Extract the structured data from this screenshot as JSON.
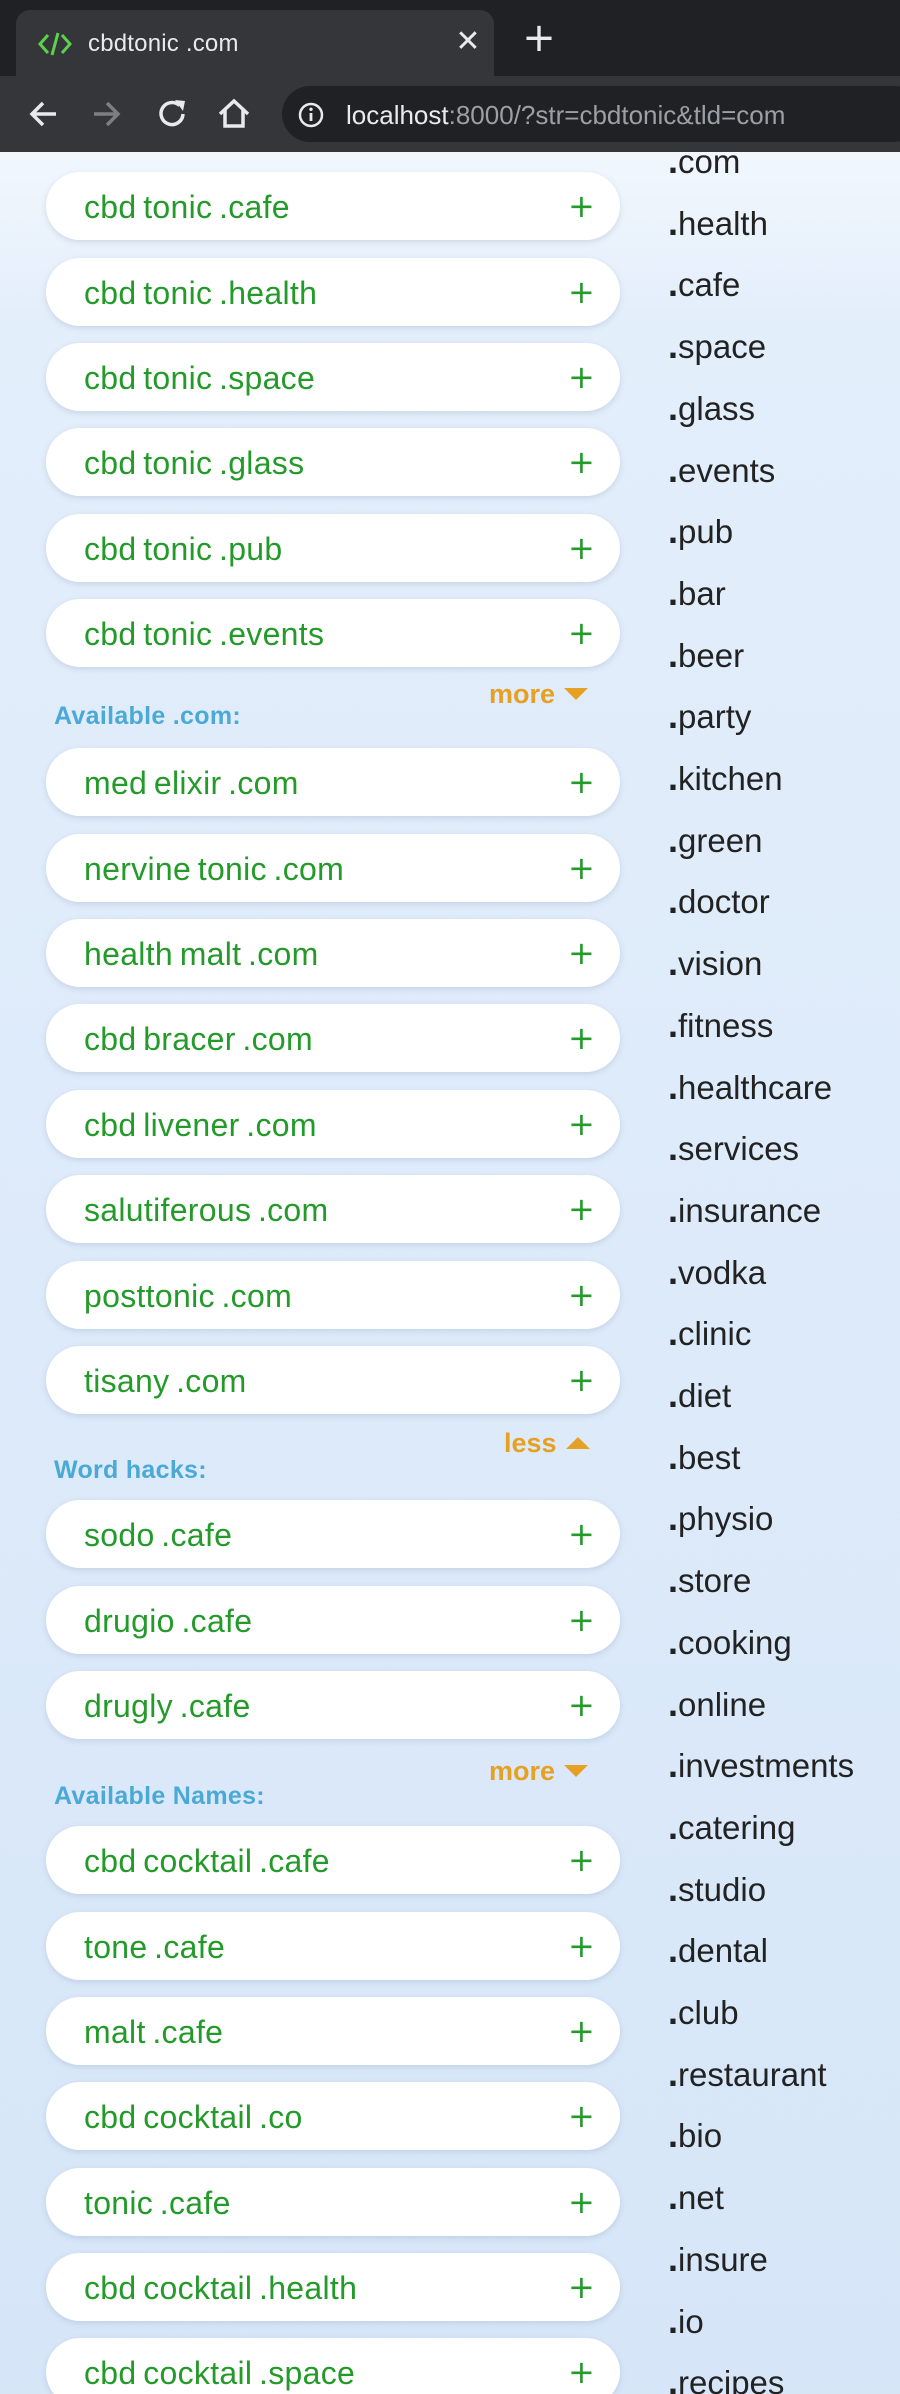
{
  "browser": {
    "tab_title": "cbdtonic .com",
    "url_host": "localhost",
    "url_rest": ":8000/?str=cbdtonic&tld=com"
  },
  "top_list": {
    "items": [
      {
        "name": "cbd tonic .cafe"
      },
      {
        "name": "cbd tonic .health"
      },
      {
        "name": "cbd tonic .space"
      },
      {
        "name": "cbd tonic .glass"
      },
      {
        "name": "cbd tonic .pub"
      },
      {
        "name": "cbd tonic .events"
      }
    ],
    "toggle": "more"
  },
  "available_com": {
    "label": "Available .com:",
    "items": [
      {
        "name": "med elixir .com"
      },
      {
        "name": "nervine tonic .com"
      },
      {
        "name": "health malt .com"
      },
      {
        "name": "cbd bracer .com"
      },
      {
        "name": "cbd livener .com"
      },
      {
        "name": "salutiferous .com"
      },
      {
        "name": "posttonic .com"
      },
      {
        "name": "tisany .com"
      }
    ],
    "toggle": "less"
  },
  "word_hacks": {
    "label": "Word hacks:",
    "items": [
      {
        "name": "sodo .cafe"
      },
      {
        "name": "drugio .cafe"
      },
      {
        "name": "drugly .cafe"
      }
    ],
    "toggle": "more"
  },
  "available_names": {
    "label": "Available Names:",
    "items": [
      {
        "name": "cbd cocktail .cafe"
      },
      {
        "name": "tone .cafe"
      },
      {
        "name": "malt .cafe"
      },
      {
        "name": "cbd cocktail .co"
      },
      {
        "name": "tonic .cafe"
      },
      {
        "name": "cbd cocktail .health"
      },
      {
        "name": "cbd cocktail .space"
      }
    ]
  },
  "plus_symbol": "+",
  "tlds": [
    "com",
    "health",
    "cafe",
    "space",
    "glass",
    "events",
    "pub",
    "bar",
    "beer",
    "party",
    "kitchen",
    "green",
    "doctor",
    "vision",
    "fitness",
    "healthcare",
    "services",
    "insurance",
    "vodka",
    "clinic",
    "diet",
    "best",
    "physio",
    "store",
    "cooking",
    "online",
    "investments",
    "catering",
    "studio",
    "dental",
    "club",
    "restaurant",
    "bio",
    "net",
    "insure",
    "io",
    "recipes"
  ],
  "colors": {
    "domain_green": "#249a2a",
    "label_blue": "#4aa9d6",
    "toggle_orange": "#e6a124"
  }
}
